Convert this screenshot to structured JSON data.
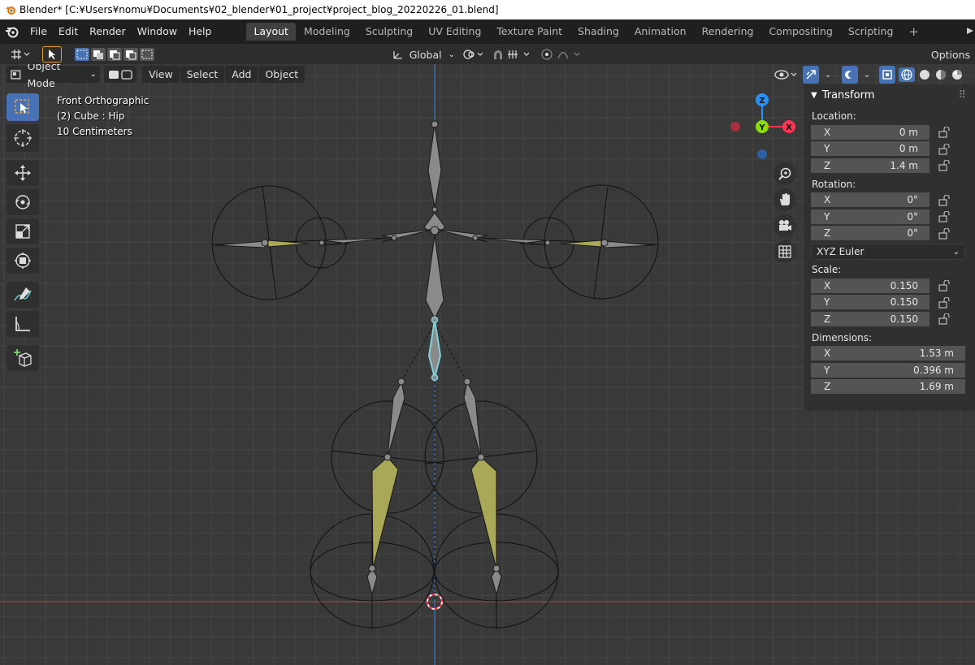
{
  "window": {
    "title": "Blender* [C:¥Users¥nomu¥Documents¥02_blender¥01_project¥project_blog_20220226_01.blend]"
  },
  "menu": {
    "items": [
      "File",
      "Edit",
      "Render",
      "Window",
      "Help"
    ]
  },
  "workspaces": {
    "tabs": [
      "Layout",
      "Modeling",
      "Sculpting",
      "UV Editing",
      "Texture Paint",
      "Shading",
      "Animation",
      "Rendering",
      "Compositing",
      "Scripting"
    ],
    "active": "Layout",
    "plus": "+"
  },
  "tool_header": {
    "orientation": "Global",
    "options": "Options"
  },
  "viewport_header": {
    "mode": "Object Mode",
    "menus": [
      "View",
      "Select",
      "Add",
      "Object"
    ]
  },
  "overlay": {
    "view_name": "Front Orthographic",
    "object_info": "(2) Cube : Hip",
    "scale_info": "10 Centimeters"
  },
  "gizmo": {
    "z": "Z",
    "y": "Y",
    "x": "X"
  },
  "tools": [
    "select-box-icon",
    "cursor-icon",
    "move-icon",
    "rotate-icon",
    "scale-icon",
    "transform-icon",
    "annotate-icon",
    "measure-icon",
    "add-cube-icon"
  ],
  "transform_panel": {
    "title": "Transform",
    "location": {
      "label": "Location:",
      "x": "0 m",
      "y": "0 m",
      "z": "1.4 m"
    },
    "rotation": {
      "label": "Rotation:",
      "x": "0°",
      "y": "0°",
      "z": "0°",
      "mode": "XYZ Euler"
    },
    "scale": {
      "label": "Scale:",
      "x": "0.150",
      "y": "0.150",
      "z": "0.150"
    },
    "dimensions": {
      "label": "Dimensions:",
      "x": "1.53 m",
      "y": "0.396 m",
      "z": "1.69 m"
    },
    "axis_labels": {
      "x": "X",
      "y": "Y",
      "z": "Z"
    }
  },
  "colors": {
    "accent": "#4772b3",
    "bone": "#8a8a8a",
    "bone_selected": "#a8a857",
    "active_bone": "#7fd3dd",
    "x_axis": "#ff3352",
    "y_axis": "#8bdc00",
    "z_axis": "#2890ff"
  }
}
